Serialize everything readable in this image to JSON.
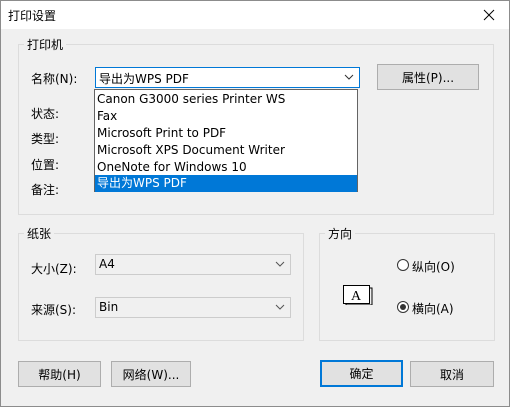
{
  "window": {
    "title": "打印设置"
  },
  "printer_group": {
    "title": "打印机",
    "name_label": "名称(N):",
    "name_value": "导出为WPS PDF",
    "properties_button": "属性(P)...",
    "status_label": "状态:",
    "type_label": "类型:",
    "where_label": "位置:",
    "comment_label": "备注:",
    "dropdown_options": [
      "Canon G3000 series Printer WS",
      "Fax",
      "Microsoft Print to PDF",
      "Microsoft XPS Document Writer",
      "OneNote for Windows 10",
      "导出为WPS PDF"
    ],
    "selected_option_index": 5
  },
  "paper_group": {
    "title": "纸张",
    "size_label": "大小(Z):",
    "size_value": "A4",
    "source_label": "来源(S):",
    "source_value": "Bin"
  },
  "orientation_group": {
    "title": "方向",
    "portrait_label": "纵向(O)",
    "landscape_label": "横向(A)",
    "selected": "landscape",
    "icon_letter": "A"
  },
  "buttons": {
    "help": "帮助(H)",
    "network": "网络(W)...",
    "ok": "确定",
    "cancel": "取消"
  },
  "colors": {
    "accent": "#0078d7",
    "dialog_bg": "#f0f0f0",
    "button_bg": "#e1e1e1"
  },
  "icons": {
    "close": "close-icon",
    "combo_arrow": "chevron-down-icon",
    "orientation": "landscape-page-icon"
  }
}
